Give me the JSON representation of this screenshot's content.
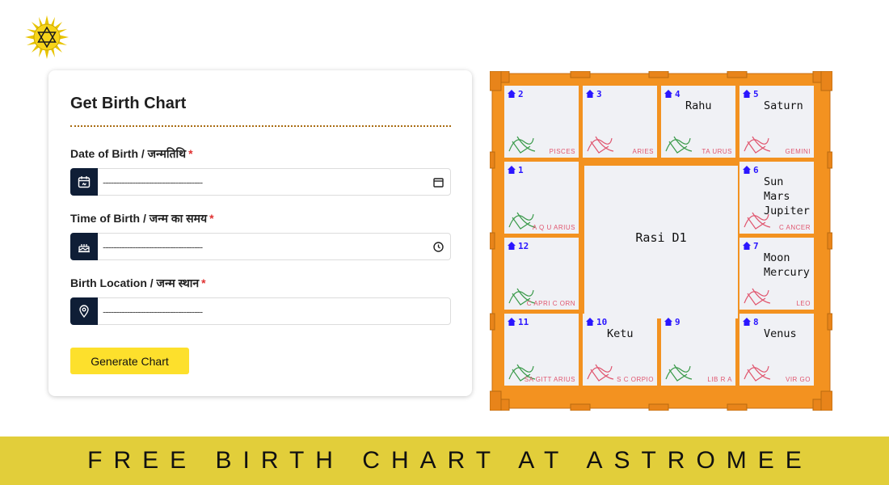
{
  "form": {
    "title": "Get Birth Chart",
    "required_mark": "*",
    "fields": [
      {
        "label": "Date of Birth / जन्मतिथि",
        "placeholder": "-------------------------------------",
        "icon": "calendar-icon"
      },
      {
        "label": "Time of Birth / जन्म का समय",
        "placeholder": "-------------------------------------",
        "icon": "birthday-cake-icon"
      },
      {
        "label": "Birth Location / जन्म स्थान",
        "placeholder": "-------------------------------------",
        "icon": "location-pin-icon"
      }
    ],
    "button_label": "Generate Chart"
  },
  "chart": {
    "center_label": "Rasi D1",
    "houses": [
      {
        "num": "2",
        "sign": "PISCES",
        "planets": []
      },
      {
        "num": "3",
        "sign": "ARIES",
        "planets": []
      },
      {
        "num": "4",
        "sign": "TA URUS",
        "planets": [
          "Rahu"
        ]
      },
      {
        "num": "5",
        "sign": "GEMINI",
        "planets": [
          "Saturn"
        ]
      },
      {
        "num": "1",
        "sign": "A Q U ARIUS",
        "planets": []
      },
      {
        "num": "6",
        "sign": "C ANCER",
        "planets": [
          "Sun",
          "Mars",
          "Jupiter"
        ]
      },
      {
        "num": "12",
        "sign": "C APRI C ORN",
        "planets": []
      },
      {
        "num": "7",
        "sign": "LEO",
        "planets": [
          "Moon",
          "Mercury"
        ]
      },
      {
        "num": "11",
        "sign": "SA GITT ARIUS",
        "planets": []
      },
      {
        "num": "10",
        "sign": "S C ORPIO",
        "planets": [
          "Ketu"
        ]
      },
      {
        "num": "9",
        "sign": "LIB R A",
        "planets": []
      },
      {
        "num": "8",
        "sign": "VIR GO",
        "planets": [
          "Venus"
        ]
      }
    ]
  },
  "footer": {
    "text": "FREE BIRTH CHART AT ASTROMEE"
  },
  "colors": {
    "frame": "#f39220",
    "cell": "#f0f1f5",
    "button": "#fde02c",
    "footer": "#e2ce3a",
    "icon_bg": "#0f1e36"
  }
}
